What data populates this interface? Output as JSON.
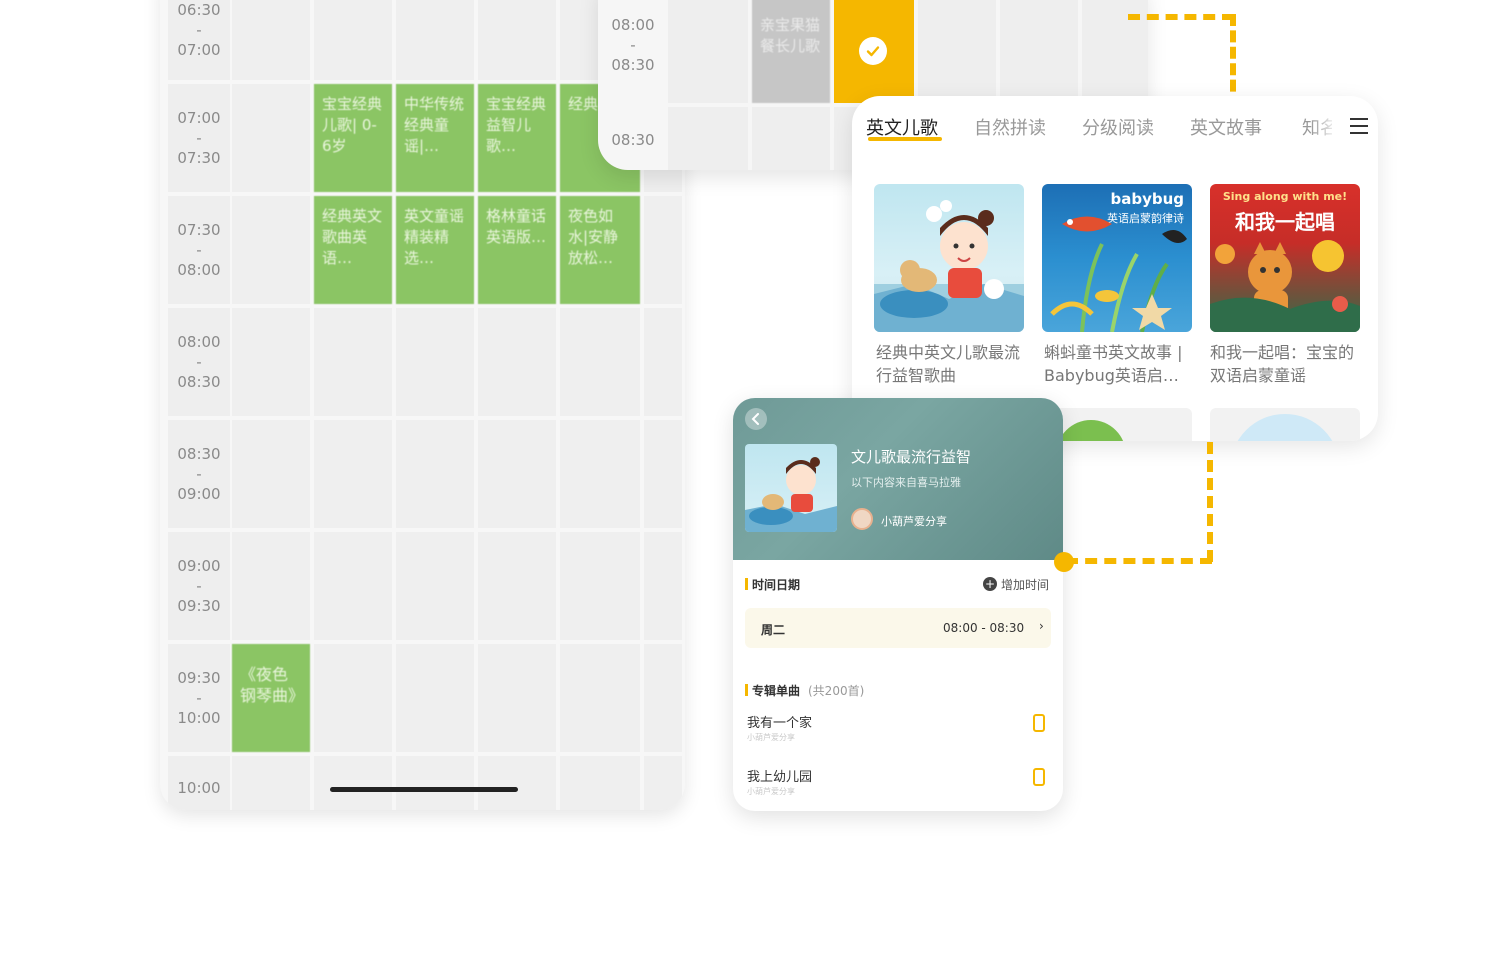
{
  "schedule": {
    "time_slots": [
      {
        "start": "06:30",
        "sep": "-",
        "end": "07:00"
      },
      {
        "start": "07:00",
        "sep": "-",
        "end": "07:30"
      },
      {
        "start": "07:30",
        "sep": "-",
        "end": "08:00"
      },
      {
        "start": "08:00",
        "sep": "-",
        "end": "08:30"
      },
      {
        "start": "08:30",
        "sep": "-",
        "end": "09:00"
      },
      {
        "start": "09:00",
        "sep": "-",
        "end": "09:30"
      },
      {
        "start": "09:30",
        "sep": "-",
        "end": "10:00"
      },
      {
        "start": "10:00",
        "sep": "",
        "end": ""
      }
    ],
    "row1": [
      "宝宝经典儿歌| 0-6岁",
      "中华传统经典童谣|…",
      "宝宝经典益智儿歌…",
      "经典歌大"
    ],
    "row2": [
      "经典英文歌曲英语…",
      "英文童谣精装精选…",
      "格林童话英语版…",
      "夜色如水|安静放松…"
    ],
    "evening_block": "《夜色钢琴曲》",
    "block_color": "#8bc564"
  },
  "overlay": {
    "time1_start": "08:00",
    "time1_sep": "-",
    "time1_end": "08:30",
    "time2_start": "08:30",
    "gray_block_text": "亲宝果猫餐长儿歌",
    "selected_color": "#f5b700"
  },
  "categories": {
    "tabs": [
      "英文儿歌",
      "自然拼读",
      "分级阅读",
      "英文故事",
      "知名"
    ],
    "active_tab": 0,
    "albums": [
      {
        "title": "经典中英文儿歌最流行益智歌曲"
      },
      {
        "title": "蝌蚪童书英文故事 | Babybug英语启…",
        "cover_text1": "babybug",
        "cover_text2": "英语启蒙韵律诗"
      },
      {
        "title": "和我一起唱：宝宝的双语启蒙童谣",
        "cover_text1": "Sing along with me!",
        "cover_text2": "和我一起唱"
      }
    ]
  },
  "detail": {
    "album_title": "文儿歌最流行益智",
    "subtitle": "以下内容来自喜马拉雅",
    "author": "小葫芦爱分享",
    "time_section_label": "时间日期",
    "add_time_label": "增加时间",
    "day": "周二",
    "time_range": "08:00 - 08:30",
    "songs_section_label": "专辑单曲",
    "songs_count": "(共200首)",
    "songs": [
      {
        "name": "我有一个家",
        "author": "小葫芦爱分享"
      },
      {
        "name": "我上幼儿园",
        "author": "小葫芦爱分享"
      }
    ],
    "accent_color": "#f5b700"
  }
}
